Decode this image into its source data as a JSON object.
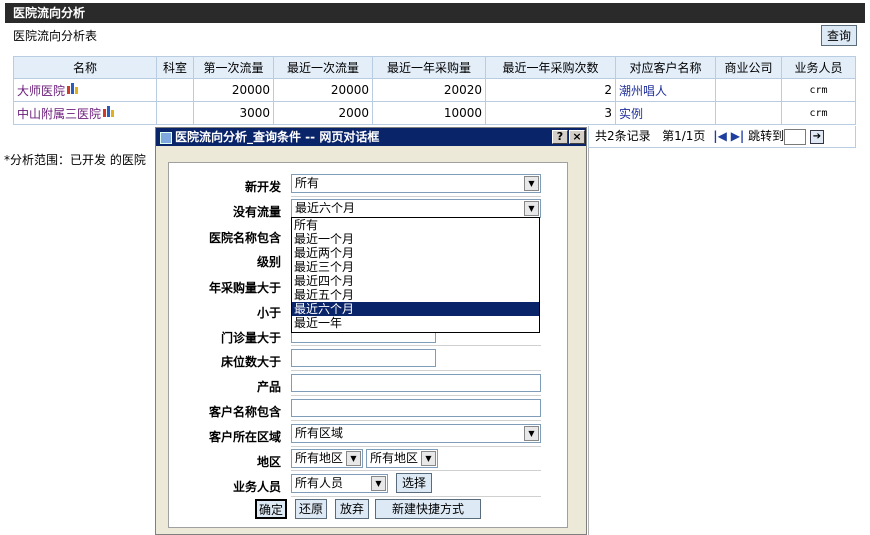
{
  "header": {
    "title": "医院流向分析",
    "subtitle": "医院流向分析表",
    "query_label": "查询"
  },
  "table": {
    "columns": [
      "名称",
      "科室",
      "第一次流量",
      "最近一次流量",
      "最近一年采购量",
      "最近一年采购次数",
      "对应客户名称",
      "商业公司",
      "业务人员"
    ],
    "rows": [
      {
        "name": "大师医院",
        "dept": "",
        "first": "20000",
        "last": "20000",
        "year_qty": "20020",
        "year_count": "2",
        "customer": "潮州唱人",
        "company": "",
        "staff": "crm"
      },
      {
        "name": "中山附属三医院",
        "dept": "",
        "first": "3000",
        "last": "2000",
        "year_qty": "10000",
        "year_count": "3",
        "customer": "实例",
        "company": "",
        "staff": "crm"
      }
    ]
  },
  "pager": {
    "summary": "共2条记录",
    "page": "第1/1页",
    "first_icon": "first-page-icon",
    "next_icon": "next-page-icon",
    "jump_label": "跳转到"
  },
  "scope_note": "*分析范围：已开发 的医院",
  "dialog": {
    "title": "医院流向分析_查询条件 -- 网页对话框",
    "help": "?",
    "close": "×",
    "fields": {
      "new_dev": {
        "label": "新开发",
        "value": "所有"
      },
      "no_flow": {
        "label": "没有流量",
        "value": "最近六个月",
        "options": [
          "所有",
          "最近一个月",
          "最近两个月",
          "最近三个月",
          "最近四个月",
          "最近五个月",
          "最近六个月",
          "最近一年"
        ],
        "selected_index": 6
      },
      "name_contains": {
        "label": "医院名称包含"
      },
      "level": {
        "label": "级别"
      },
      "year_qty_gt": {
        "label": "年采购量大于"
      },
      "less_than": {
        "label": "小于"
      },
      "outpatient_gt": {
        "label": "门诊量大于"
      },
      "beds_gt": {
        "label": "床位数大于"
      },
      "product": {
        "label": "产品"
      },
      "customer_contains": {
        "label": "客户名称包含"
      },
      "customer_region": {
        "label": "客户所在区域",
        "value": "所有区域"
      },
      "area": {
        "label": "地区",
        "value1": "所有地区",
        "value2": "所有地区"
      },
      "staff": {
        "label": "业务人员",
        "value": "所有人员",
        "select_label": "选择"
      }
    },
    "buttons": {
      "ok": "确定",
      "reset": "还原",
      "abandon": "放弃",
      "shortcut": "新建快捷方式"
    }
  }
}
